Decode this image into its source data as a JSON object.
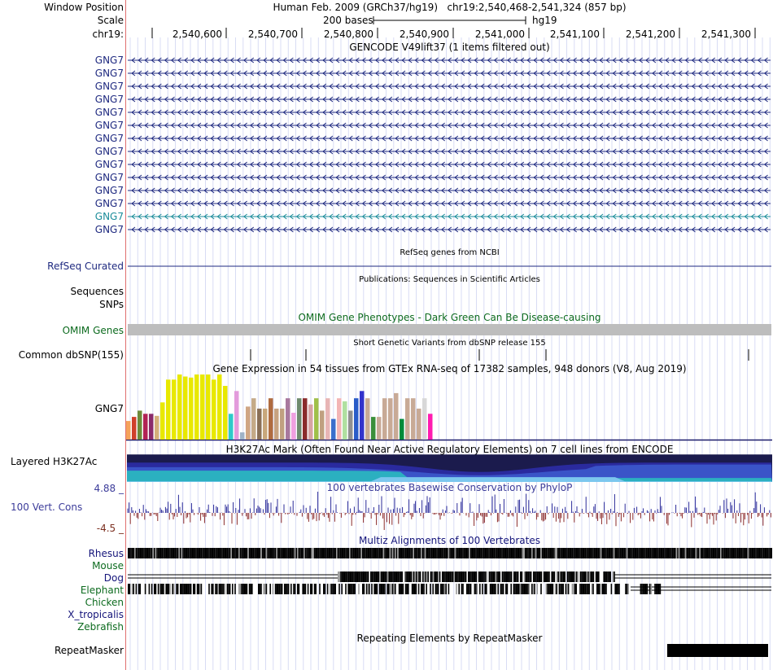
{
  "header": {
    "window_position_label": "Window Position",
    "scale_label": "Scale",
    "chrom_label": "chr19:",
    "assembly_text": "Human Feb. 2009 (GRCh37/hg19)",
    "position_text": "chr19:2,540,468-2,541,324 (857 bp)",
    "scale_text": "200 bases",
    "scale_db": "hg19",
    "ruler_ticks": [
      "2,540,600",
      "2,540,700",
      "2,540,800",
      "2,540,900",
      "2,541,000",
      "2,541,100",
      "2,541,200",
      "2,541,300"
    ]
  },
  "gencode": {
    "title": "GENCODE V49lift37 (1 items filtered out)",
    "items": [
      {
        "label": "GNG7",
        "color": "#1f2a80"
      },
      {
        "label": "GNG7",
        "color": "#1f2a80"
      },
      {
        "label": "GNG7",
        "color": "#1f2a80"
      },
      {
        "label": "GNG7",
        "color": "#1f2a80"
      },
      {
        "label": "GNG7",
        "color": "#1f2a80"
      },
      {
        "label": "GNG7",
        "color": "#1f2a80"
      },
      {
        "label": "GNG7",
        "color": "#1f2a80"
      },
      {
        "label": "GNG7",
        "color": "#1f2a80"
      },
      {
        "label": "GNG7",
        "color": "#1f2a80"
      },
      {
        "label": "GNG7",
        "color": "#1f2a80"
      },
      {
        "label": "GNG7",
        "color": "#1f2a80"
      },
      {
        "label": "GNG7",
        "color": "#1f2a80"
      },
      {
        "label": "GNG7",
        "color": "#1b8c9a"
      },
      {
        "label": "GNG7",
        "color": "#1f2a80"
      }
    ]
  },
  "refseq": {
    "title": "RefSeq genes from NCBI",
    "label": "RefSeq Curated"
  },
  "publications": {
    "title": "Publications: Sequences in Scientific Articles",
    "label1": "Sequences",
    "label2": "SNPs"
  },
  "omim": {
    "title": "OMIM Gene Phenotypes - Dark Green Can Be Disease-causing",
    "label": "OMIM Genes"
  },
  "dbsnp": {
    "title": "Short Genetic Variants from dbSNP release 155",
    "label": "Common dbSNP(155)"
  },
  "gtex": {
    "title": "Gene Expression in 54 tissues from GTEx RNA-seq of 17382 samples, 948 donors (V8, Aug 2019)",
    "label": "GNG7"
  },
  "h3k27ac": {
    "title": "H3K27Ac Mark (Often Found Near Active Regulatory Elements) on 7 cell lines from ENCODE",
    "label": "Layered H3K27Ac"
  },
  "phylop": {
    "title": "100 vertebrates Basewise Conservation by PhyloP",
    "label": "100 Vert. Cons",
    "max_label": "4.88 _",
    "min_label": "-4.5 _"
  },
  "multiz": {
    "title": "Multiz Alignments of 100 Vertebrates",
    "species": [
      {
        "label": "Rhesus",
        "color": "#14147a"
      },
      {
        "label": "Mouse",
        "color": "#0d6b1f"
      },
      {
        "label": "Dog",
        "color": "#14147a"
      },
      {
        "label": "Elephant",
        "color": "#0d6b1f"
      },
      {
        "label": "Chicken",
        "color": "#0d6b1f"
      },
      {
        "label": "X_tropicalis",
        "color": "#14147a"
      },
      {
        "label": "Zebrafish",
        "color": "#0d6b1f"
      }
    ]
  },
  "repeatmasker": {
    "title": "Repeating Elements by RepeatMasker",
    "label": "RepeatMasker"
  },
  "chart_data": {
    "type": "bar",
    "title": "Gene Expression in 54 tissues from GTEx RNA-seq of 17382 samples, 948 donors (V8, Aug 2019)",
    "values": [
      0.18,
      0.22,
      0.28,
      0.25,
      0.25,
      0.23,
      0.36,
      0.58,
      0.58,
      0.63,
      0.61,
      0.6,
      0.63,
      0.63,
      0.63,
      0.58,
      0.63,
      0.52,
      0.25,
      0.47,
      0.07,
      0.32,
      0.4,
      0.3,
      0.3,
      0.4,
      0.3,
      0.3,
      0.4,
      0.26,
      0.4,
      0.4,
      0.34,
      0.4,
      0.28,
      0.4,
      0.2,
      0.4,
      0.37,
      0.28,
      0.4,
      0.47,
      0.4,
      0.22,
      0.22,
      0.4,
      0.4,
      0.45,
      0.2,
      0.4,
      0.4,
      0.3,
      0.4,
      0.25
    ],
    "colors": [
      "#f5a25a",
      "#d0402b",
      "#6e8a3a",
      "#b22254",
      "#8a2b6b",
      "#d4af7a",
      "#e8e800",
      "#e8e800",
      "#e8e800",
      "#e8e800",
      "#e8e800",
      "#e8e800",
      "#e8e800",
      "#e8e800",
      "#e8e800",
      "#e8e800",
      "#e8e800",
      "#e8e800",
      "#2ecaca",
      "#e39bdc",
      "#9fb2c7",
      "#d0a684",
      "#c5aa88",
      "#8a6f57",
      "#c8a77c",
      "#b06b3f",
      "#c7a280",
      "#c0a080",
      "#a8789e",
      "#f0a0e0",
      "#6e8a6e",
      "#8a2b2b",
      "#d7a4a4",
      "#a0c04a",
      "#c0a080",
      "#e8b5b5",
      "#3a6fcc",
      "#f3b5b5",
      "#b0e0a0",
      "#909090",
      "#2a5cc8",
      "#3333cc",
      "#c8aa96",
      "#3a8f3a",
      "#c8aa96",
      "#c8aa96",
      "#c8aa96",
      "#c8aa96",
      "#008b3a",
      "#c8aa96",
      "#c8aa96",
      "#c8aa96",
      "#d8d8d8",
      "#ff1cb0"
    ]
  }
}
